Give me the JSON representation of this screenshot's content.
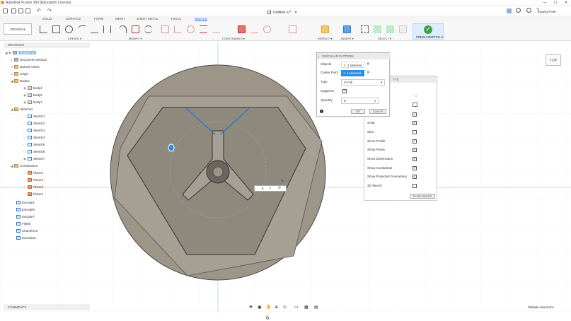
{
  "titlebar": {
    "title": "Autodesk Fusion 360 (Education License)",
    "min": "—",
    "max": "☐",
    "close": "✕"
  },
  "doc": {
    "tab_title": "Untitled v1*"
  },
  "user": {
    "name": "Evgeny Park"
  },
  "ribbon": {
    "tabs": [
      "SOLID",
      "SURFACE",
      "FORM",
      "MESH",
      "SHEET METAL",
      "TOOLS",
      "SKETCH"
    ],
    "active_tab": "SKETCH",
    "workspace": "DESIGN ▾",
    "groups": {
      "create": "CREATE ▾",
      "modify": "MODIFY ▾",
      "constraints": "CONSTRAINTS ▾",
      "inspect": "INSPECT ▾",
      "insert": "INSERT ▾",
      "select": "SELECT ▾"
    },
    "finish": "FINISH SKETCH ▾"
  },
  "browser": {
    "header": "BROWSER",
    "root": "Untitled v1",
    "items": [
      {
        "label": "Document Settings"
      },
      {
        "label": "Named Views"
      },
      {
        "label": "Origin"
      },
      {
        "label": "Bodies"
      },
      {
        "label": "Body1"
      },
      {
        "label": "Body5"
      },
      {
        "label": "Body7"
      },
      {
        "label": "Sketches"
      },
      {
        "label": "Sketch1"
      },
      {
        "label": "Sketch2"
      },
      {
        "label": "Sketch3"
      },
      {
        "label": "Sketch4"
      },
      {
        "label": "Sketch5"
      },
      {
        "label": "Sketch6"
      },
      {
        "label": "Sketch7"
      },
      {
        "label": "Construction"
      },
      {
        "label": "Plane1"
      },
      {
        "label": "Plane2"
      },
      {
        "label": "Plane3"
      },
      {
        "label": "Plane4"
      }
    ],
    "timeline": [
      {
        "label": "Extrude1"
      },
      {
        "label": "Extrude6"
      },
      {
        "label": "Extrude7"
      },
      {
        "label": "Fillet9"
      },
      {
        "label": "Chamfer10"
      },
      {
        "label": "Extrude11"
      }
    ]
  },
  "circular_pattern": {
    "title": "CIRCULAR PATTERN",
    "objects_label": "Objects",
    "objects_value": "2 selected",
    "center_label": "Center Point",
    "center_value": "1 selected",
    "type_label": "Type",
    "type_value": "Full",
    "suppress_label": "Suppress",
    "quantity_label": "Quantity",
    "quantity_value": "6",
    "ok": "OK",
    "cancel": "Cancel"
  },
  "palette": {
    "title": "TTE",
    "rows": [
      {
        "label": "Snap"
      },
      {
        "label": "Slice"
      },
      {
        "label": "Show Profile"
      },
      {
        "label": "Show Points"
      },
      {
        "label": "Show Dimensions"
      },
      {
        "label": "Show Constraints"
      },
      {
        "label": "Show Projected Geometries"
      },
      {
        "label": "3D Sketch"
      }
    ],
    "finish": "Finish Sketch"
  },
  "viewcube": {
    "face": "TOP"
  },
  "canvas": {
    "number_label": "6",
    "inline_input": "6"
  },
  "comments": {
    "label": "COMMENTS"
  },
  "status": {
    "text": "Multiple selections"
  },
  "colors": {
    "accent": "#2b8de0",
    "body": "#9c9588",
    "finish": "#43a047"
  }
}
